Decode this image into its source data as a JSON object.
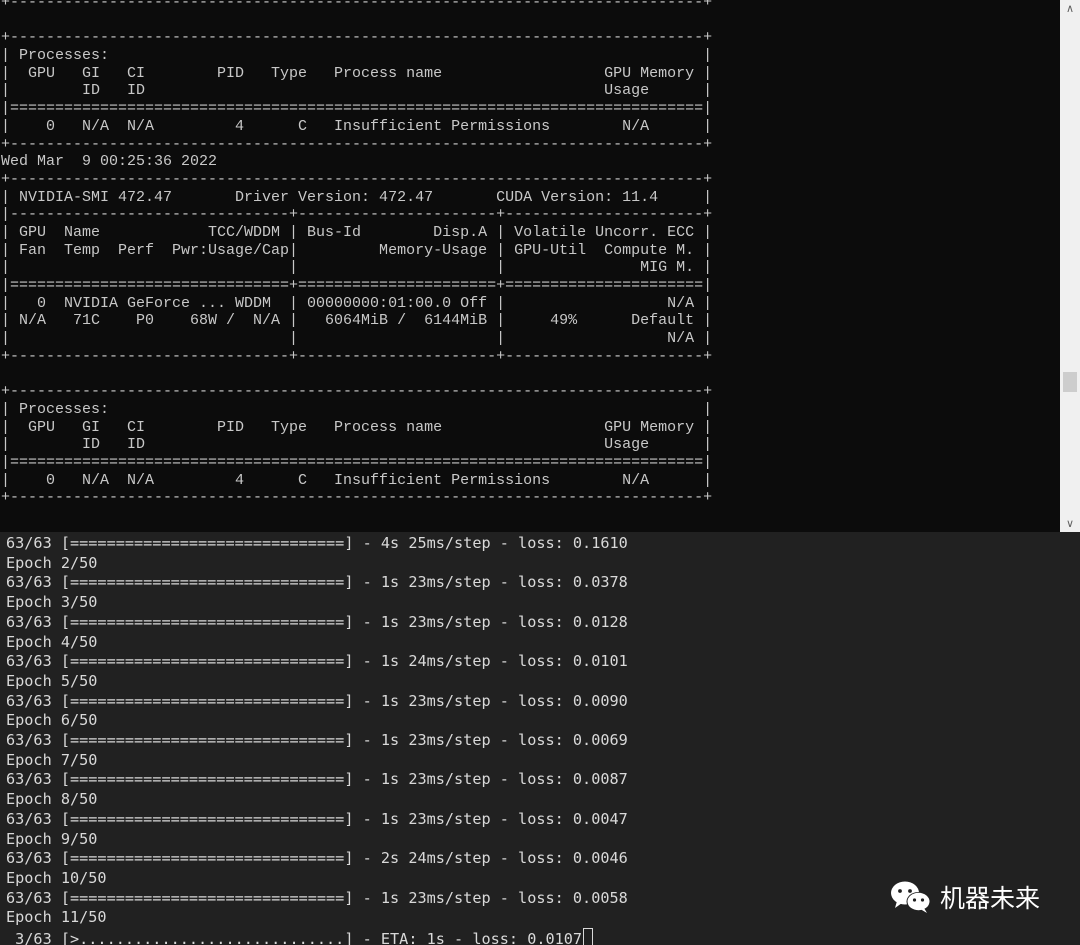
{
  "top_terminal": {
    "lines": [
      "+-----------------------------------------------------------------------------+",
      "",
      "+-----------------------------------------------------------------------------+",
      "| Processes:                                                                  |",
      "|  GPU   GI   CI        PID   Type   Process name                  GPU Memory |",
      "|        ID   ID                                                   Usage      |",
      "|=============================================================================|",
      "|    0   N/A  N/A         4      C   Insufficient Permissions        N/A      |",
      "+-----------------------------------------------------------------------------+",
      "Wed Mar  9 00:25:36 2022",
      "+-----------------------------------------------------------------------------+",
      "| NVIDIA-SMI 472.47       Driver Version: 472.47       CUDA Version: 11.4     |",
      "|-------------------------------+----------------------+----------------------+",
      "| GPU  Name            TCC/WDDM | Bus-Id        Disp.A | Volatile Uncorr. ECC |",
      "| Fan  Temp  Perf  Pwr:Usage/Cap|         Memory-Usage | GPU-Util  Compute M. |",
      "|                               |                      |               MIG M. |",
      "|===============================+======================+======================|",
      "|   0  NVIDIA GeForce ... WDDM  | 00000000:01:00.0 Off |                  N/A |",
      "| N/A   71C    P0    68W /  N/A |   6064MiB /  6144MiB |     49%      Default |",
      "|                               |                      |                  N/A |",
      "+-------------------------------+----------------------+----------------------+",
      "",
      "+-----------------------------------------------------------------------------+",
      "| Processes:                                                                  |",
      "|  GPU   GI   CI        PID   Type   Process name                  GPU Memory |",
      "|        ID   ID                                                   Usage      |",
      "|=============================================================================|",
      "|    0   N/A  N/A         4      C   Insufficient Permissions        N/A      |",
      "+-----------------------------------------------------------------------------+"
    ]
  },
  "bottom_terminal": {
    "lines": [
      "63/63 [==============================] - 4s 25ms/step - loss: 0.1610",
      "Epoch 2/50",
      "63/63 [==============================] - 1s 23ms/step - loss: 0.0378",
      "Epoch 3/50",
      "63/63 [==============================] - 1s 23ms/step - loss: 0.0128",
      "Epoch 4/50",
      "63/63 [==============================] - 1s 24ms/step - loss: 0.0101",
      "Epoch 5/50",
      "63/63 [==============================] - 1s 23ms/step - loss: 0.0090",
      "Epoch 6/50",
      "63/63 [==============================] - 1s 23ms/step - loss: 0.0069",
      "Epoch 7/50",
      "63/63 [==============================] - 1s 23ms/step - loss: 0.0087",
      "Epoch 8/50",
      "63/63 [==============================] - 1s 23ms/step - loss: 0.0047",
      "Epoch 9/50",
      "63/63 [==============================] - 2s 24ms/step - loss: 0.0046",
      "Epoch 10/50",
      "63/63 [==============================] - 1s 23ms/step - loss: 0.0058",
      "Epoch 11/50"
    ],
    "current_line": " 3/63 [>.............................] - ETA: 1s - loss: 0.0107"
  },
  "scrollbar": {
    "up_arrow": "∧",
    "down_arrow": "∨"
  },
  "watermark": {
    "text": "机器未来",
    "icon": "wechat-icon"
  },
  "colors": {
    "top_bg": "#0c0c0c",
    "top_fg": "#c8c8c8",
    "bottom_bg": "#212121",
    "bottom_fg": "#d9d9d9"
  }
}
